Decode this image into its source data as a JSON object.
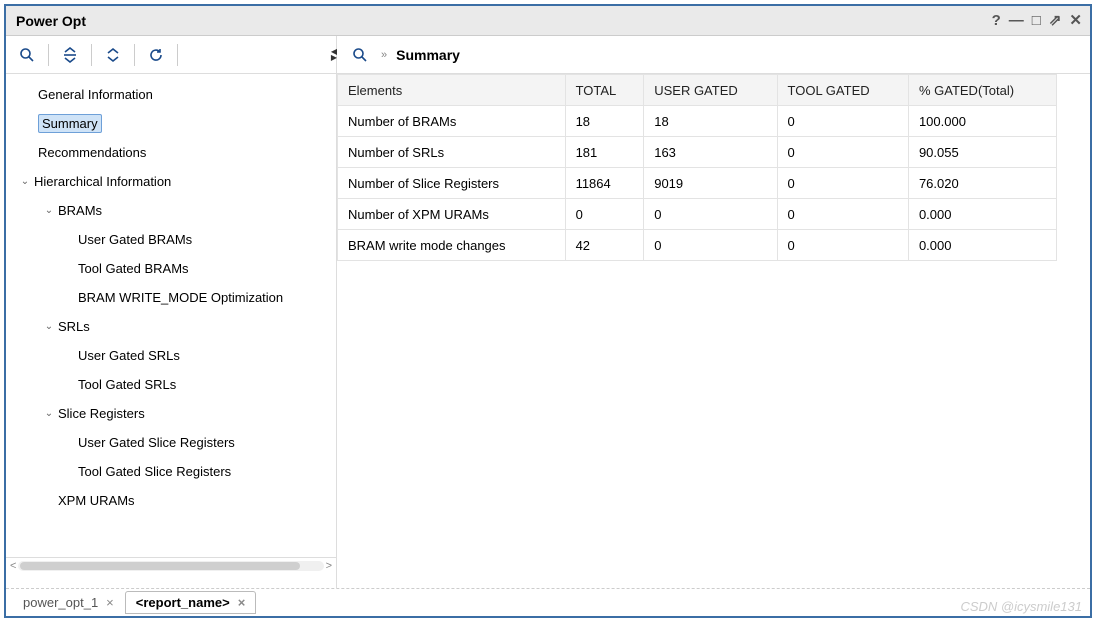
{
  "window": {
    "title": "Power Opt"
  },
  "content": {
    "heading": "Summary"
  },
  "tree": {
    "general_info": "General Information",
    "summary": "Summary",
    "recommendations": "Recommendations",
    "hierarchical": "Hierarchical Information",
    "brams": "BRAMs",
    "brams_user": "User Gated BRAMs",
    "brams_tool": "Tool Gated BRAMs",
    "brams_wm": "BRAM WRITE_MODE Optimization",
    "srls": "SRLs",
    "srls_user": "User Gated SRLs",
    "srls_tool": "Tool Gated SRLs",
    "sliceregs": "Slice Registers",
    "sliceregs_user": "User Gated Slice Registers",
    "sliceregs_tool": "Tool Gated Slice Registers",
    "xpm_urams": "XPM URAMs"
  },
  "table": {
    "headers": {
      "elements": "Elements",
      "total": "TOTAL",
      "user_gated": "USER GATED",
      "tool_gated": "TOOL GATED",
      "pct_gated": "% GATED(Total)"
    },
    "rows": [
      {
        "elements": "Number of BRAMs",
        "total": "18",
        "user": "18",
        "tool": "0",
        "pct": "100.000"
      },
      {
        "elements": "Number of SRLs",
        "total": "181",
        "user": "163",
        "tool": "0",
        "pct": "90.055"
      },
      {
        "elements": "Number of Slice Registers",
        "total": "11864",
        "user": "9019",
        "tool": "0",
        "pct": "76.020"
      },
      {
        "elements": "Number of XPM URAMs",
        "total": "0",
        "user": "0",
        "tool": "0",
        "pct": "0.000"
      },
      {
        "elements": "BRAM write mode changes",
        "total": "42",
        "user": "0",
        "tool": "0",
        "pct": "0.000"
      }
    ]
  },
  "tabs": {
    "t0": "power_opt_1",
    "t1": "<report_name>"
  },
  "watermark": "CSDN @icysmile131"
}
